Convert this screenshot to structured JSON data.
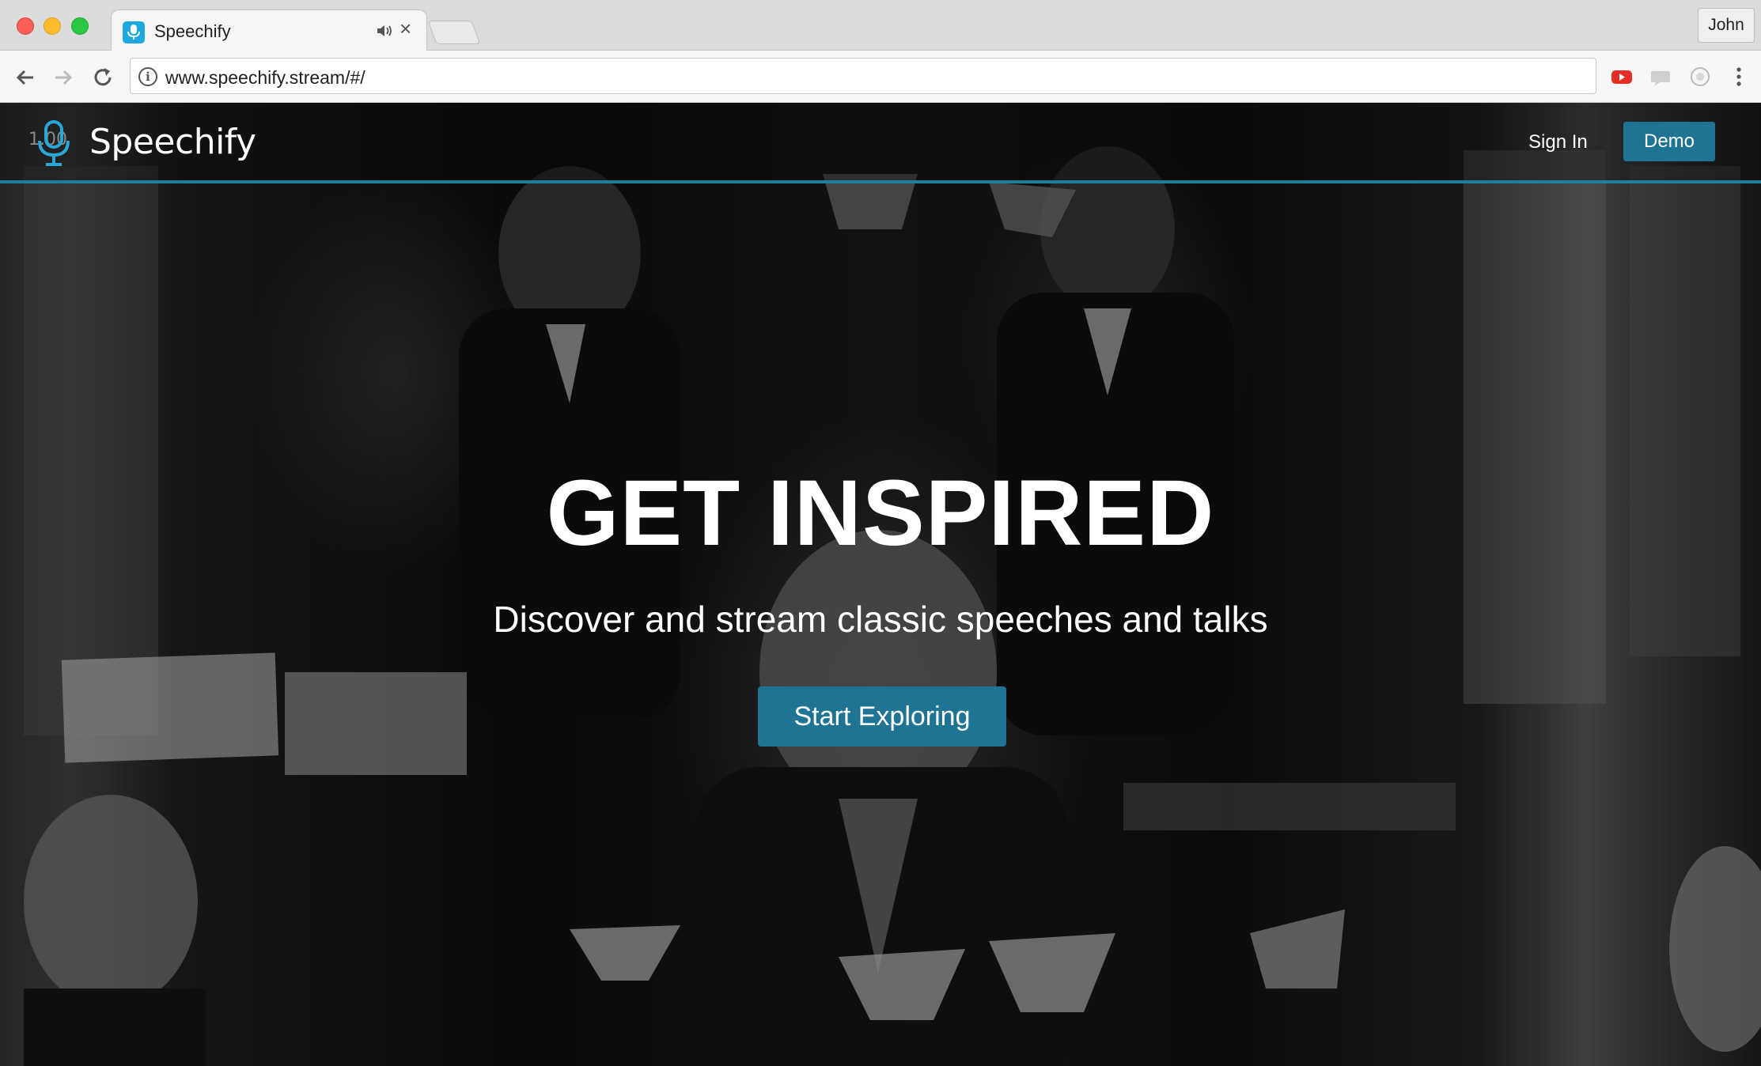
{
  "browser": {
    "tab": {
      "title": "Speechify"
    },
    "profile_name": "John",
    "url": "www.speechify.stream/#/",
    "extensions": [
      "youtube-extension-icon",
      "css-extension-icon",
      "circle-extension-icon",
      "menu-icon"
    ]
  },
  "site": {
    "brand": {
      "ticker": "1.00",
      "name": "Speechify"
    },
    "nav": {
      "signin_label": "Sign In",
      "demo_label": "Demo"
    },
    "hero": {
      "title": "GET INSPIRED",
      "subtitle": "Discover and stream classic speeches and talks",
      "cta_label": "Start Exploring"
    },
    "colors": {
      "accent": "#1f7393",
      "nav_border": "#1f7f9b"
    }
  }
}
